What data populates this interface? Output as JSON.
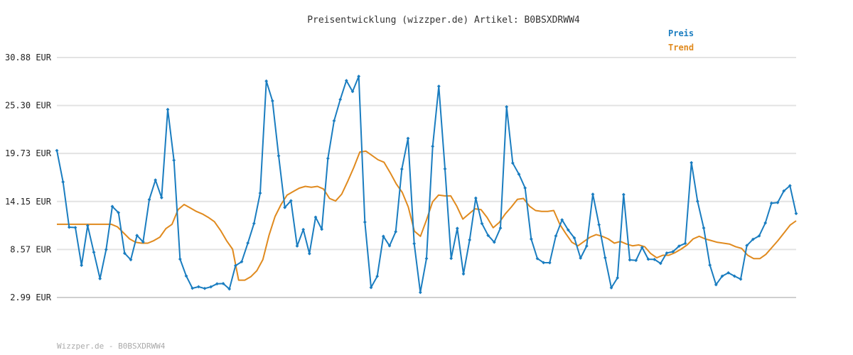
{
  "chart_data": {
    "type": "line",
    "title": "Preisentwicklung (wizzper.de) Artikel: B0BSXDRWW4",
    "ylabel": "",
    "xlabel": "",
    "yticks": [
      "2.99 EUR",
      "8.57 EUR",
      "14.15 EUR",
      "19.73 EUR",
      "25.30 EUR",
      "30.88 EUR"
    ],
    "ytick_values": [
      2.99,
      8.57,
      14.15,
      19.73,
      25.3,
      30.88
    ],
    "ylim": [
      2.99,
      30.88
    ],
    "grid": true,
    "legend_position": "top-right",
    "series": [
      {
        "name": "Preis",
        "color": "#1a7dc0",
        "markers": true,
        "values": [
          20.07,
          16.42,
          11.16,
          11.12,
          6.73,
          11.34,
          8.25,
          5.18,
          8.56,
          13.57,
          12.85,
          8.13,
          7.38,
          10.2,
          9.45,
          14.37,
          16.64,
          14.59,
          24.84,
          18.94,
          7.45,
          5.49,
          4.06,
          4.24,
          4.04,
          4.23,
          4.58,
          4.61,
          3.98,
          6.69,
          7.15,
          9.32,
          11.59,
          15.12,
          28.14,
          25.84,
          19.45,
          13.45,
          14.23,
          8.97,
          10.89,
          8.09,
          12.32,
          10.92,
          19.15,
          23.53,
          26.0,
          28.2,
          26.93,
          28.69,
          11.75,
          4.15,
          5.45,
          10.1,
          9.0,
          10.63,
          17.92,
          21.48,
          9.25,
          3.58,
          7.52,
          20.56,
          27.54,
          17.94,
          7.53,
          11.02,
          5.73,
          9.68,
          14.54,
          11.58,
          10.2,
          9.42,
          11.06,
          25.15,
          18.61,
          17.32,
          15.72,
          9.78,
          7.51,
          7.04,
          7.03,
          10.15,
          12.01,
          10.84,
          9.91,
          7.57,
          8.97,
          14.99,
          11.45,
          7.61,
          4.12,
          5.27,
          14.95,
          7.36,
          7.3,
          8.81,
          7.44,
          7.41,
          6.95,
          8.16,
          8.31,
          8.96,
          9.28,
          18.66,
          14.17,
          11.07,
          6.75,
          4.48,
          5.47,
          5.86,
          5.47,
          5.12,
          9.03,
          9.75,
          10.15,
          11.65,
          13.95,
          14.02,
          15.37,
          15.98,
          12.75
        ]
      },
      {
        "name": "Trend",
        "color": "#e08a1e",
        "markers": false,
        "values": [
          11.5,
          11.5,
          11.5,
          11.5,
          11.5,
          11.5,
          11.5,
          11.5,
          11.5,
          11.5,
          11.2,
          10.5,
          9.8,
          9.4,
          9.3,
          9.3,
          9.6,
          10.0,
          11.0,
          11.5,
          13.2,
          13.8,
          13.4,
          13.0,
          12.7,
          12.3,
          11.8,
          10.8,
          9.6,
          8.6,
          5.0,
          5.0,
          5.4,
          6.1,
          7.4,
          10.2,
          12.4,
          13.8,
          14.9,
          15.3,
          15.7,
          15.9,
          15.8,
          15.9,
          15.6,
          14.5,
          14.2,
          15.0,
          16.5,
          18.1,
          19.9,
          20.0,
          19.5,
          19.0,
          18.7,
          17.5,
          16.2,
          15.2,
          13.5,
          10.7,
          10.1,
          12.0,
          14.1,
          14.9,
          14.8,
          14.8,
          13.6,
          12.1,
          12.7,
          13.3,
          13.2,
          12.3,
          11.1,
          11.7,
          12.7,
          13.5,
          14.4,
          14.5,
          13.6,
          13.1,
          13.0,
          13.0,
          13.1,
          11.5,
          10.4,
          9.4,
          9.0,
          9.5,
          10.0,
          10.3,
          10.1,
          9.8,
          9.3,
          9.5,
          9.2,
          9.0,
          9.1,
          8.9,
          8.1,
          7.6,
          7.9,
          7.9,
          8.2,
          8.6,
          9.1,
          9.8,
          10.1,
          9.8,
          9.6,
          9.4,
          9.3,
          9.2,
          8.9,
          8.7,
          7.9,
          7.5,
          7.5,
          8.0,
          8.8,
          9.6,
          10.5,
          11.4,
          11.9
        ]
      }
    ]
  },
  "footer": {
    "text": "Wizzper.de - B0BSXDRWW4"
  }
}
